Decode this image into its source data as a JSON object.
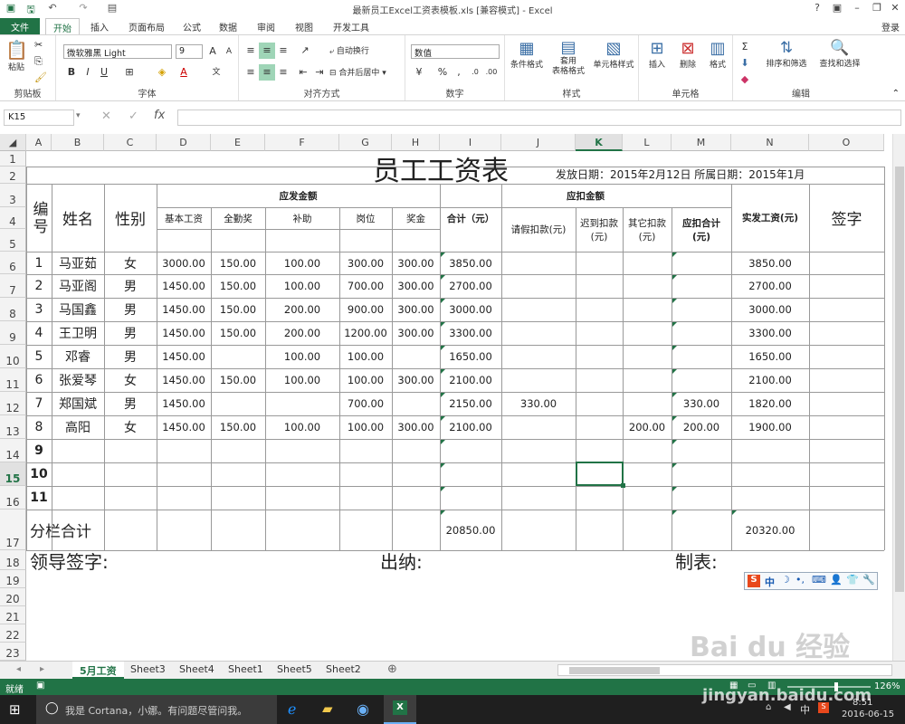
{
  "window": {
    "title": "最新员工Excel工资表模板.xls  [兼容模式] - Excel",
    "login": "登录"
  },
  "ribbon_tabs": [
    "文件",
    "开始",
    "插入",
    "页面布局",
    "公式",
    "数据",
    "审阅",
    "视图",
    "开发工具"
  ],
  "ribbon": {
    "clipboard": {
      "label": "剪贴板",
      "paste": "粘贴"
    },
    "font": {
      "label": "字体",
      "name": "微软雅黑 Light",
      "size": "9"
    },
    "align": {
      "label": "对齐方式",
      "wrap": "自动换行",
      "merge": "合并后居中"
    },
    "number": {
      "label": "数字",
      "format": "数值"
    },
    "styles": {
      "label": "样式",
      "cond": "条件格式",
      "table": "套用\n表格格式",
      "cell": "单元格样式"
    },
    "cells": {
      "label": "单元格",
      "insert": "插入",
      "delete": "删除",
      "format": "格式"
    },
    "edit": {
      "label": "编辑",
      "sort": "排序和筛选",
      "find": "查找和选择"
    }
  },
  "formula_bar": {
    "name_box": "K15",
    "fx": "fx",
    "content": ""
  },
  "columns": [
    "A",
    "B",
    "C",
    "D",
    "E",
    "F",
    "G",
    "H",
    "I",
    "J",
    "K",
    "L",
    "M",
    "N",
    "O"
  ],
  "selected_column": "K",
  "selected_row": "15",
  "rows": [
    "1",
    "2",
    "3",
    "4",
    "5",
    "6",
    "7",
    "8",
    "9",
    "10",
    "11",
    "12",
    "13",
    "14",
    "15",
    "16",
    "17",
    "18",
    "19",
    "20",
    "21",
    "22",
    "23"
  ],
  "sheet": {
    "title": "员工工资表",
    "date_info": "发放日期：2015年2月12日  所属日期：2015年1月",
    "h_no": "编号",
    "h_name": "姓名",
    "h_gender": "性别",
    "h_pay": "应发金额",
    "h_deduct": "应扣金额",
    "h_basic": "基本工资",
    "h_attend": "全勤奖",
    "h_subsidy": "补助",
    "h_post": "岗位",
    "h_bonus": "奖金",
    "h_total": "合计（元）",
    "h_leave": "请假扣款(元)",
    "h_late": "迟到扣款(元)",
    "h_other": "其它扣款(元)",
    "h_dtotal": "应扣合计(元)",
    "h_net": "实发工资(元)",
    "h_sign": "签字",
    "employees": [
      {
        "no": "1",
        "name": "马亚茹",
        "gender": "女",
        "basic": "3000.00",
        "attend": "150.00",
        "subsidy": "100.00",
        "post": "300.00",
        "bonus": "300.00",
        "total": "3850.00",
        "leave": "",
        "late": "",
        "other": "",
        "dtotal": "",
        "net": "3850.00"
      },
      {
        "no": "2",
        "name": "马亚阁",
        "gender": "男",
        "basic": "1450.00",
        "attend": "150.00",
        "subsidy": "100.00",
        "post": "700.00",
        "bonus": "300.00",
        "total": "2700.00",
        "leave": "",
        "late": "",
        "other": "",
        "dtotal": "",
        "net": "2700.00"
      },
      {
        "no": "3",
        "name": "马国鑫",
        "gender": "男",
        "basic": "1450.00",
        "attend": "150.00",
        "subsidy": "200.00",
        "post": "900.00",
        "bonus": "300.00",
        "total": "3000.00",
        "leave": "",
        "late": "",
        "other": "",
        "dtotal": "",
        "net": "3000.00"
      },
      {
        "no": "4",
        "name": "王卫明",
        "gender": "男",
        "basic": "1450.00",
        "attend": "150.00",
        "subsidy": "200.00",
        "post": "1200.00",
        "bonus": "300.00",
        "total": "3300.00",
        "leave": "",
        "late": "",
        "other": "",
        "dtotal": "",
        "net": "3300.00"
      },
      {
        "no": "5",
        "name": "邓睿",
        "gender": "男",
        "basic": "1450.00",
        "attend": "",
        "subsidy": "100.00",
        "post": "100.00",
        "bonus": "",
        "total": "1650.00",
        "leave": "",
        "late": "",
        "other": "",
        "dtotal": "",
        "net": "1650.00"
      },
      {
        "no": "6",
        "name": "张爱琴",
        "gender": "女",
        "basic": "1450.00",
        "attend": "150.00",
        "subsidy": "100.00",
        "post": "100.00",
        "bonus": "300.00",
        "total": "2100.00",
        "leave": "",
        "late": "",
        "other": "",
        "dtotal": "",
        "net": "2100.00"
      },
      {
        "no": "7",
        "name": "郑国斌",
        "gender": "男",
        "basic": "1450.00",
        "attend": "",
        "subsidy": "",
        "post": "700.00",
        "bonus": "",
        "total": "2150.00",
        "leave": "330.00",
        "late": "",
        "other": "",
        "dtotal": "330.00",
        "net": "1820.00"
      },
      {
        "no": "8",
        "name": "高阳",
        "gender": "女",
        "basic": "1450.00",
        "attend": "150.00",
        "subsidy": "100.00",
        "post": "100.00",
        "bonus": "300.00",
        "total": "2100.00",
        "leave": "",
        "late": "",
        "other": "200.00",
        "dtotal": "200.00",
        "net": "1900.00"
      }
    ],
    "empty_nos": [
      "9",
      "10",
      "11"
    ],
    "subtotal_label": "分栏合计",
    "subtotal_total": "20850.00",
    "subtotal_net": "20320.00",
    "sign_leader": "领导签字:",
    "sign_cashier": "出纳:",
    "sign_maker": "制表:"
  },
  "sheet_tabs": [
    "5月工资",
    "Sheet3",
    "Sheet4",
    "Sheet1",
    "Sheet5",
    "Sheet2"
  ],
  "status": {
    "ready": "就绪",
    "zoom": "126%"
  },
  "taskbar": {
    "cortana": "我是 Cortana，小娜。有问题尽管问我。",
    "time": "8:51",
    "date": "2016-06-15",
    "ime": "中"
  },
  "watermark": {
    "logo": "Bai du 经验",
    "url": "jingyan.baidu.com"
  },
  "colors": {
    "excel_green": "#217346",
    "grid": "#999999",
    "taskbar": "#1f1f1f"
  }
}
